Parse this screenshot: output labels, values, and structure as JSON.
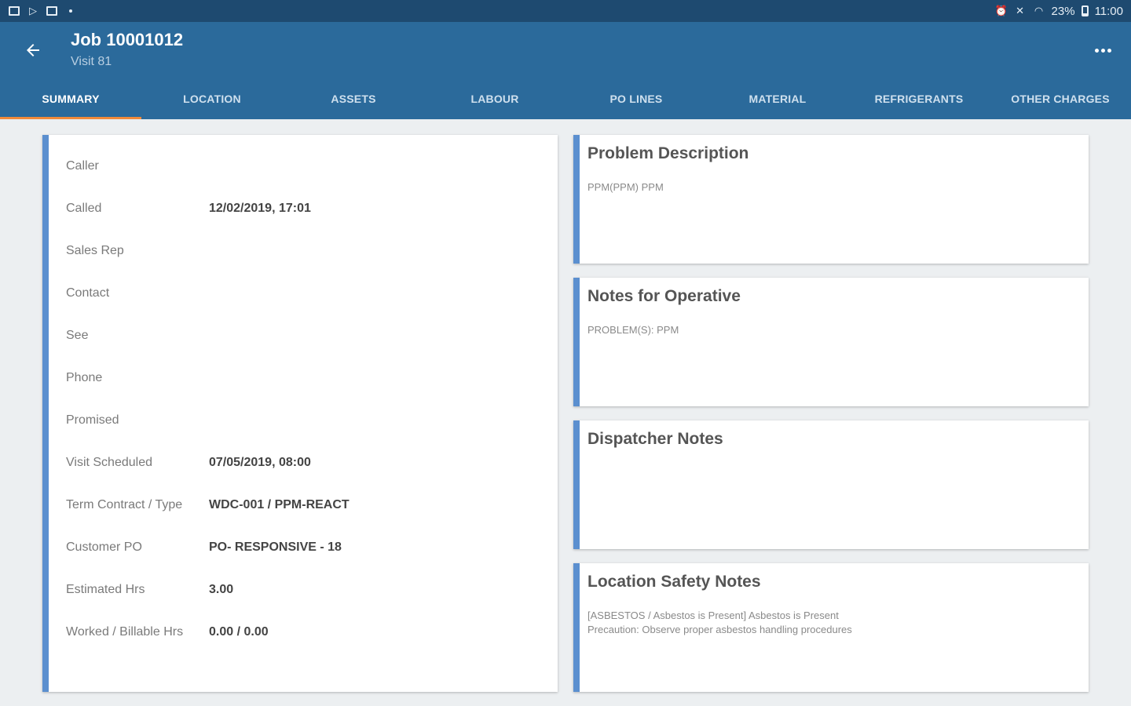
{
  "status_bar": {
    "left_icons": [
      "image-icon",
      "play-store-icon",
      "screen-icon",
      "dot-icon"
    ],
    "battery_text": "23%",
    "time": "11:00"
  },
  "header": {
    "title": "Job 10001012",
    "subtitle": "Visit 81"
  },
  "tabs": [
    "SUMMARY",
    "LOCATION",
    "ASSETS",
    "LABOUR",
    "PO LINES",
    "MATERIAL",
    "REFRIGERANTS",
    "OTHER CHARGES"
  ],
  "summary": {
    "fields": [
      {
        "label": "Caller",
        "value": ""
      },
      {
        "label": "Called",
        "value": "12/02/2019, 17:01"
      },
      {
        "label": "Sales Rep",
        "value": ""
      },
      {
        "label": "Contact",
        "value": ""
      },
      {
        "label": "See",
        "value": ""
      },
      {
        "label": "Phone",
        "value": ""
      },
      {
        "label": "Promised",
        "value": ""
      },
      {
        "label": "Visit Scheduled",
        "value": "07/05/2019, 08:00"
      },
      {
        "label": "Term Contract / Type",
        "value": "WDC-001 / PPM-REACT"
      },
      {
        "label": "Customer PO",
        "value": "PO- RESPONSIVE - 18"
      },
      {
        "label": "Estimated Hrs",
        "value": "3.00"
      },
      {
        "label": "Worked / Billable Hrs",
        "value": "0.00 / 0.00"
      }
    ]
  },
  "cards": [
    {
      "title": "Problem Description",
      "lines": [
        "PPM(PPM) PPM"
      ]
    },
    {
      "title": "Notes for Operative",
      "lines": [
        "PROBLEM(S): PPM"
      ]
    },
    {
      "title": "Dispatcher Notes",
      "lines": []
    },
    {
      "title": "Location Safety Notes",
      "lines": [
        "[ASBESTOS / Asbestos is Present] Asbestos is Present",
        "Precaution: Observe proper asbestos handling procedures"
      ]
    }
  ],
  "colors": {
    "status_bar": "#1e4a70",
    "app_bar": "#2b6a9b",
    "tab_indicator": "#f28a3a",
    "card_accent": "#5b8fcf",
    "background": "#eceff1"
  }
}
